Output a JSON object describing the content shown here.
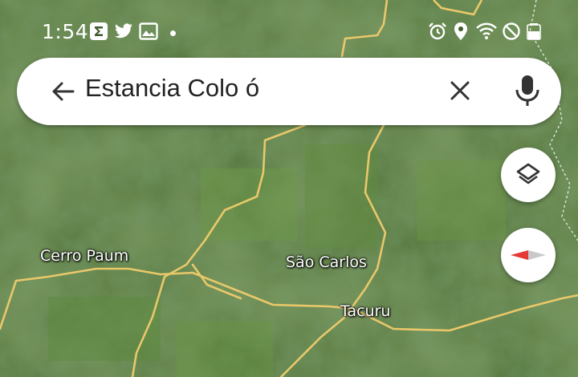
{
  "status_bar": {
    "time": "1:54",
    "left_icons": [
      "sigma-app-icon",
      "twitter-icon",
      "image-icon"
    ],
    "right_icons": [
      "alarm-icon",
      "location-icon",
      "wifi-icon",
      "do-not-disturb-icon",
      "battery-icon"
    ]
  },
  "search": {
    "query": "Estancia Colo ó",
    "back_icon": "arrow-left-icon",
    "clear_icon": "close-icon",
    "mic_icon": "microphone-icon"
  },
  "map": {
    "mode": "satellite",
    "places": [
      "Cerro Paum",
      "São Carlos",
      "Tacuru"
    ]
  },
  "controls": {
    "layers_icon": "layers-icon",
    "compass_icon": "compass-icon"
  },
  "colors": {
    "road": "#e9c86a",
    "compass_north": "#e53935",
    "field_dark": "#2f4a22",
    "field_light": "#5f8a3a"
  }
}
